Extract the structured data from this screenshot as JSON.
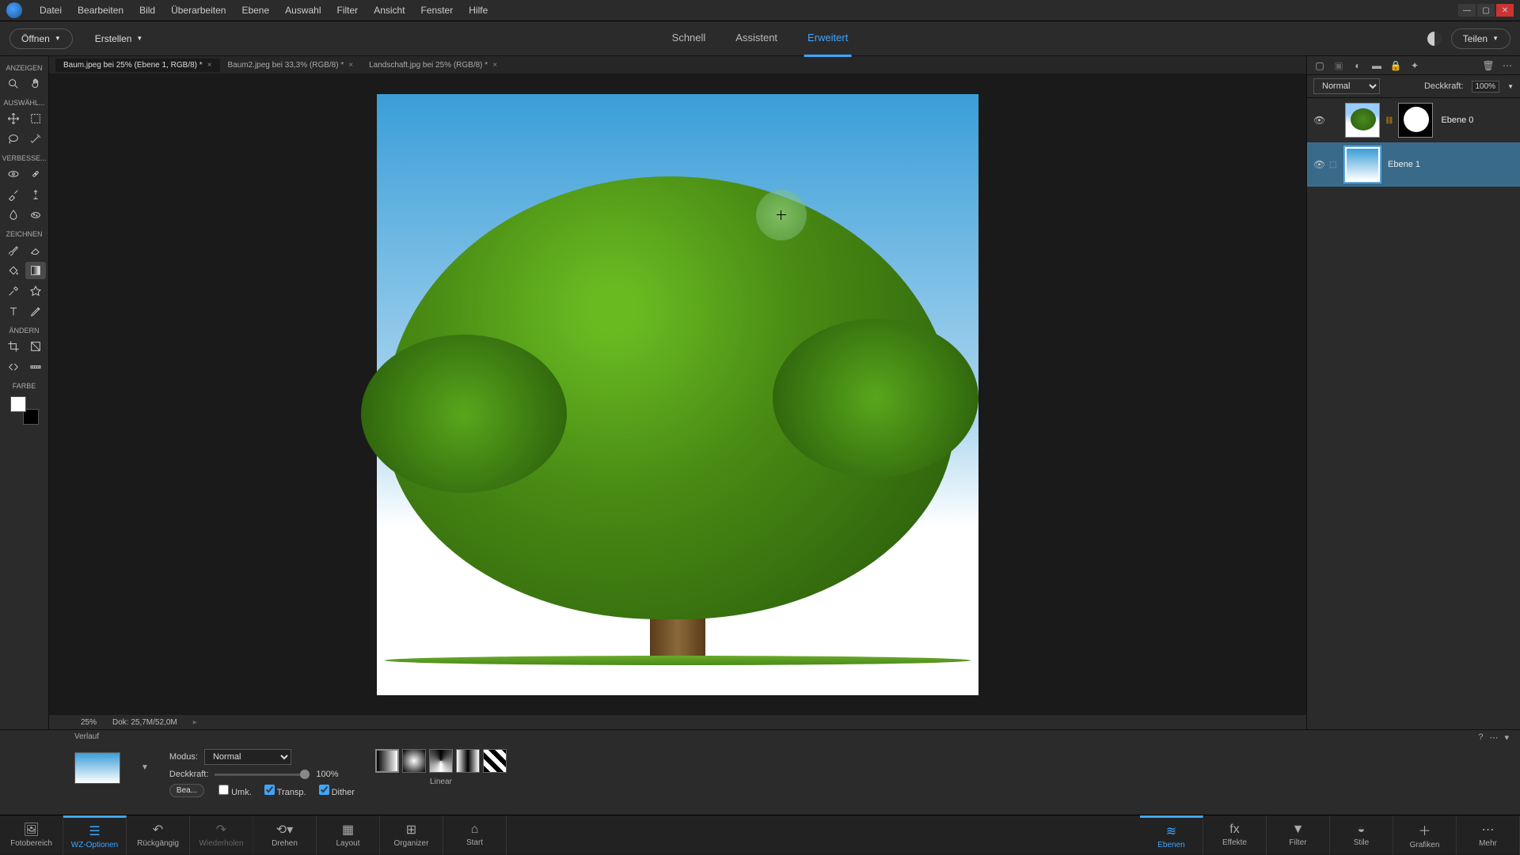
{
  "menubar": [
    "Datei",
    "Bearbeiten",
    "Bild",
    "Überarbeiten",
    "Ebene",
    "Auswahl",
    "Filter",
    "Ansicht",
    "Fenster",
    "Hilfe"
  ],
  "topbar": {
    "open": "Öffnen",
    "create": "Erstellen",
    "share": "Teilen"
  },
  "modes": {
    "quick": "Schnell",
    "guided": "Assistent",
    "expert": "Erweitert"
  },
  "toolbox": {
    "view": "ANZEIGEN",
    "select": "AUSWÄHL...",
    "enhance": "VERBESSE...",
    "draw": "ZEICHNEN",
    "modify": "ÄNDERN",
    "color": "FARBE"
  },
  "doctabs": [
    {
      "label": "Baum.jpeg bei 25% (Ebene 1, RGB/8) *",
      "active": true
    },
    {
      "label": "Baum2.jpeg bei 33,3% (RGB/8) *",
      "active": false
    },
    {
      "label": "Landschaft.jpg bei 25% (RGB/8) *",
      "active": false
    }
  ],
  "status": {
    "zoom": "25%",
    "doc": "Dok: 25,7M/52,0M"
  },
  "options": {
    "title": "Verlauf",
    "edit": "Bea...",
    "mode_label": "Modus:",
    "mode_val": "Normal",
    "opacity_label": "Deckkraft:",
    "opacity_val": "100%",
    "reverse": "Umk.",
    "transp": "Transp.",
    "dither": "Dither",
    "type_label": "Linear"
  },
  "layers_panel": {
    "blend": "Normal",
    "opacity_label": "Deckkraft:",
    "opacity_val": "100%",
    "layer0": "Ebene 0",
    "layer1": "Ebene 1"
  },
  "taskbar": {
    "photobin": "Fotobereich",
    "tooloptions": "WZ-Optionen",
    "undo": "Rückgängig",
    "redo": "Wiederholen",
    "rotate": "Drehen",
    "layout": "Layout",
    "organizer": "Organizer",
    "home": "Start",
    "layers": "Ebenen",
    "effects": "Effekte",
    "filter": "Filter",
    "styles": "Stile",
    "graphics": "Grafiken",
    "more": "Mehr"
  }
}
